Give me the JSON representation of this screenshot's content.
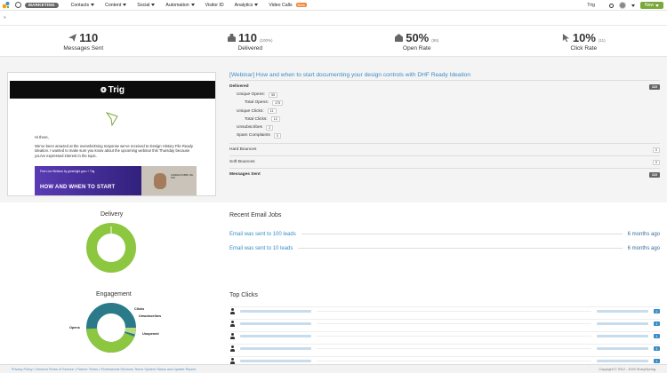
{
  "nav": {
    "badge": "MARKETING",
    "items": [
      "Contacts",
      "Content",
      "Social",
      "Automation",
      "Visitor ID",
      "Analytics",
      "Video Calls"
    ],
    "beta": "Beta",
    "org": "Trig",
    "new_label": "New"
  },
  "stats": [
    {
      "value": "110",
      "suffix": "",
      "label": "Messages Sent",
      "icon": "paper-plane-icon"
    },
    {
      "value": "110",
      "suffix": "(100%)",
      "label": "Delivered",
      "icon": "inbox-icon"
    },
    {
      "value": "50%",
      "suffix": "(55)",
      "label": "Open Rate",
      "icon": "open-envelope-icon"
    },
    {
      "value": "10%",
      "suffix": "(11)",
      "label": "Click Rate",
      "icon": "cursor-icon"
    }
  ],
  "preview": {
    "brand": "Trig",
    "greeting": "Hi there,",
    "body": "We've been amazed at the overwhelming response we've received to Design History File Ready Ideation. I wanted to make sure you know about the upcoming webinar this Thursday because you've expressed interest in the topic.",
    "banner_tag": "Free Live Webinar by greenlight.guru + Trig",
    "banner_title": "HOW AND WHEN TO START",
    "banner_person": "ANDREW DIBBS, BE, PhD"
  },
  "subject": "[Webinar] How and when to start documenting your design controls with DHF Ready Ideation",
  "delivery": {
    "delivered_label": "Delivered",
    "delivered_value": "110",
    "unique_opens_label": "Unique Opens:",
    "unique_opens": "55",
    "total_opens_label": "Total Opens:",
    "total_opens": "175",
    "unique_clicks_label": "Unique Clicks:",
    "unique_clicks": "11",
    "total_clicks_label": "Total Clicks:",
    "total_clicks": "12",
    "unsubscribes_label": "Unsubscribes",
    "unsubscribes": "2",
    "spam_label": "Spam Complaints",
    "spam": "0",
    "hard_bounces_label": "Hard Bounces",
    "hard_bounces": "0",
    "soft_bounces_label": "Soft Bounces",
    "soft_bounces": "0",
    "messages_sent_label": "Messages Sent",
    "messages_sent": "110"
  },
  "charts": {
    "delivery_title": "Delivery",
    "engagement_title": "Engagement",
    "engagement_labels": {
      "clicks": "Clicks",
      "unsubscribes": "Unsubscribes",
      "opens": "Opens",
      "unopened": "Unopened"
    },
    "colors": {
      "green": "#8dc63f",
      "teal": "#2b7a8a",
      "lime": "#b9d97a"
    }
  },
  "jobs": {
    "title": "Recent Email Jobs",
    "rows": [
      {
        "label": "Email was sent to 100 leads",
        "ago": "6 months ago"
      },
      {
        "label": "Email was sent to 10 leads",
        "ago": "6 months ago"
      }
    ]
  },
  "top_clicks": {
    "title": "Top Clicks",
    "counts": [
      "2",
      "1",
      "1",
      "1",
      "1"
    ]
  },
  "footer": {
    "links": "Privacy Policy  •  General Terms of Service  •  Partner Terms  •  Professional Services Terms   System Status and Update Report",
    "copyright": "Copyright © 2012 - 2020 SharpSpring"
  }
}
